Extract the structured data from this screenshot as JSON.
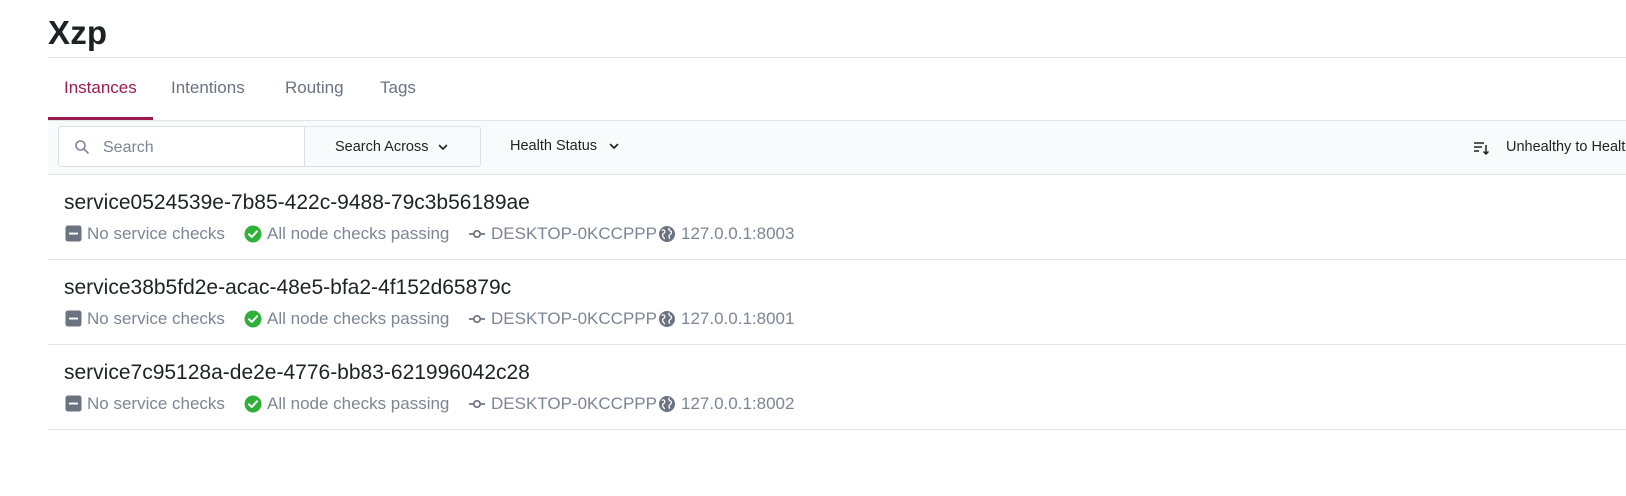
{
  "page": {
    "title": "Xzp"
  },
  "tabs": [
    {
      "label": "Instances",
      "active": true
    },
    {
      "label": "Intentions",
      "active": false
    },
    {
      "label": "Routing",
      "active": false
    },
    {
      "label": "Tags",
      "active": false
    }
  ],
  "toolbar": {
    "search": {
      "placeholder": "Search",
      "value": ""
    },
    "search_across": "Search Across",
    "health_status": "Health Status",
    "sort_label": "Unhealthy to Healthy"
  },
  "instances": [
    {
      "name": "service0524539e-7b85-422c-9488-79c3b56189ae",
      "service_checks": "No service checks",
      "node_checks": "All node checks passing",
      "node": "DESKTOP-0KCCPPP",
      "address": "127.0.0.1:8003"
    },
    {
      "name": "service38b5fd2e-acac-48e5-bfa2-4f152d65879c",
      "service_checks": "No service checks",
      "node_checks": "All node checks passing",
      "node": "DESKTOP-0KCCPPP",
      "address": "127.0.0.1:8001"
    },
    {
      "name": "service7c95128a-de2e-4776-bb83-621996042c28",
      "service_checks": "No service checks",
      "node_checks": "All node checks passing",
      "node": "DESKTOP-0KCCPPP",
      "address": "127.0.0.1:8002"
    }
  ],
  "colors": {
    "accent": "#9b1c4c",
    "passing": "#2eb039",
    "muted": "#7c8594"
  },
  "icons": {
    "service_checks": "minus-square-icon",
    "node_checks": "check-circle-icon",
    "node": "git-commit-icon",
    "address": "globe-icon",
    "search": "search-icon",
    "sort": "sort-icon"
  }
}
